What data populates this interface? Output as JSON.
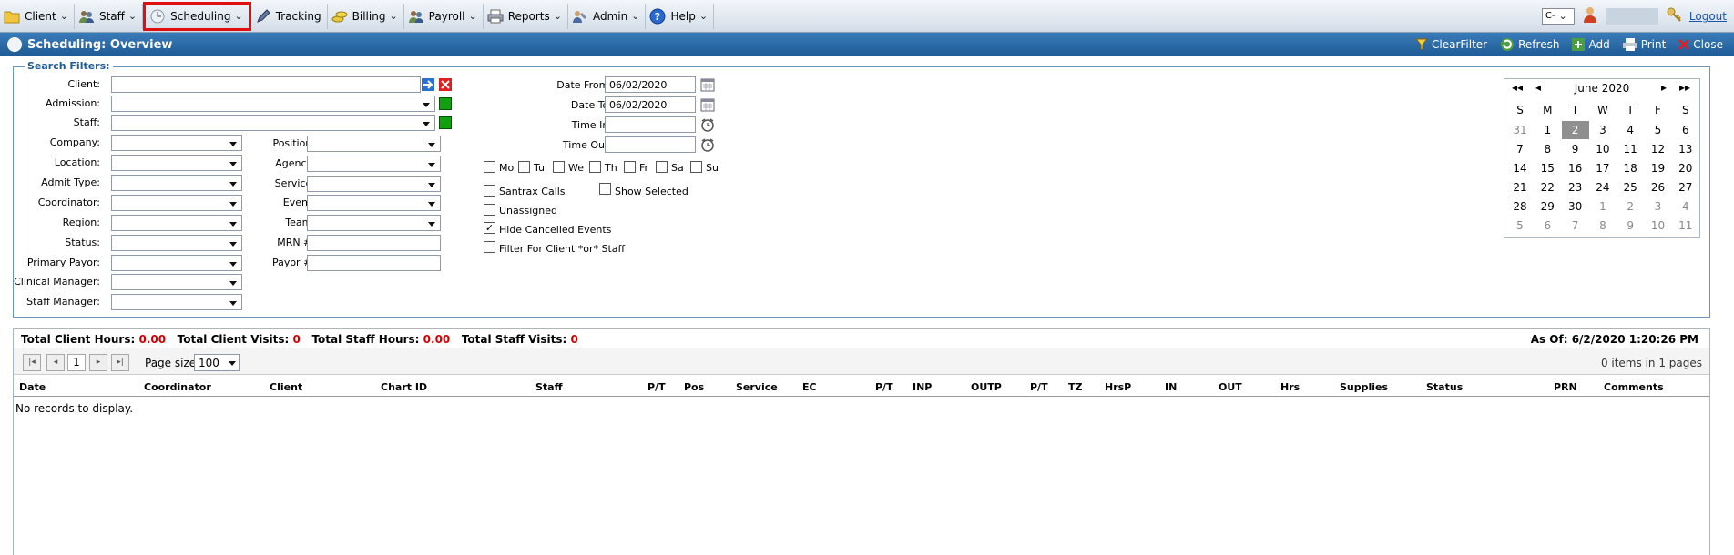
{
  "menubar": {
    "items": [
      {
        "label": "Client",
        "icon": "folder-icon"
      },
      {
        "label": "Staff",
        "icon": "people-icon"
      },
      {
        "label": "Scheduling",
        "icon": "clock-icon",
        "selected": true
      },
      {
        "label": "Tracking",
        "icon": "pencil-icon"
      },
      {
        "label": "Billing",
        "icon": "coins-icon"
      },
      {
        "label": "Payroll",
        "icon": "people-icon"
      },
      {
        "label": "Reports",
        "icon": "printer-icon"
      },
      {
        "label": "Admin",
        "icon": "admin-icon"
      },
      {
        "label": "Help",
        "icon": "help-icon"
      }
    ],
    "company_select": "C-",
    "logout": "Logout"
  },
  "titlebar": {
    "title": "Scheduling: Overview",
    "actions": {
      "clearfilter": "ClearFilter",
      "refresh": "Refresh",
      "add": "Add",
      "print": "Print",
      "close": "Close"
    }
  },
  "filters": {
    "legend": "Search Filters:",
    "client": "Client:",
    "admission": "Admission:",
    "staff": "Staff:",
    "company": "Company:",
    "location": "Location:",
    "admit_type": "Admit Type:",
    "coordinator": "Coordinator:",
    "region": "Region:",
    "status": "Status:",
    "primary_payor": "Primary Payor:",
    "clinical_manager": "Clinical Manager:",
    "staff_manager": "Staff Manager:",
    "position": "Position:",
    "agency": "Agency:",
    "service": "Service:",
    "event": "Event:",
    "team": "Team:",
    "mrn": "MRN #:",
    "payor": "Payor #:",
    "date_from_label": "Date From:",
    "date_from": "06/02/2020",
    "date_to_label": "Date To:",
    "date_to": "06/02/2020",
    "time_in": "Time In:",
    "time_out": "Time Out:",
    "days": [
      "Mo",
      "Tu",
      "We",
      "Th",
      "Fr",
      "Sa",
      "Su"
    ],
    "santrax": "Santrax Calls",
    "show_selected": "Show Selected",
    "unassigned": "Unassigned",
    "hide_cancelled": "Hide Cancelled Events",
    "filter_client_or_staff": "Filter For Client *or* Staff"
  },
  "calendar": {
    "month": "June 2020",
    "nav": {
      "prev_year": "◂◂",
      "prev": "◂",
      "next": "▸",
      "next_year": "▸▸"
    },
    "weekdays": [
      "S",
      "M",
      "T",
      "W",
      "T",
      "F",
      "S"
    ],
    "weeks": [
      [
        "31",
        "1",
        "2",
        "3",
        "4",
        "5",
        "6"
      ],
      [
        "7",
        "8",
        "9",
        "10",
        "11",
        "12",
        "13"
      ],
      [
        "14",
        "15",
        "16",
        "17",
        "18",
        "19",
        "20"
      ],
      [
        "21",
        "22",
        "23",
        "24",
        "25",
        "26",
        "27"
      ],
      [
        "28",
        "29",
        "30",
        "1",
        "2",
        "3",
        "4"
      ],
      [
        "5",
        "6",
        "7",
        "8",
        "9",
        "10",
        "11"
      ]
    ],
    "selected": "2"
  },
  "summary": {
    "client_hours_label": "Total Client Hours:",
    "client_hours": "0.00",
    "client_visits_label": "Total Client Visits:",
    "client_visits": "0",
    "staff_hours_label": "Total Staff Hours:",
    "staff_hours": "0.00",
    "staff_visits_label": "Total Staff Visits:",
    "staff_visits": "0",
    "as_of": "As Of: 6/2/2020 1:20:26 PM"
  },
  "pager": {
    "page": "1",
    "page_size_label": "Page size:",
    "page_size": "100",
    "items_info": "0 items in 1 pages"
  },
  "grid": {
    "columns": [
      "Date",
      "Coordinator",
      "Client",
      "Chart ID",
      "Staff",
      "P/T",
      "Pos",
      "Service",
      "EC",
      "P/T",
      "INP",
      "OUTP",
      "P/T",
      "TZ",
      "HrsP",
      "IN",
      "OUT",
      "Hrs",
      "Supplies",
      "Status",
      "PRN",
      "Comments"
    ],
    "empty_text": "No records to display."
  }
}
